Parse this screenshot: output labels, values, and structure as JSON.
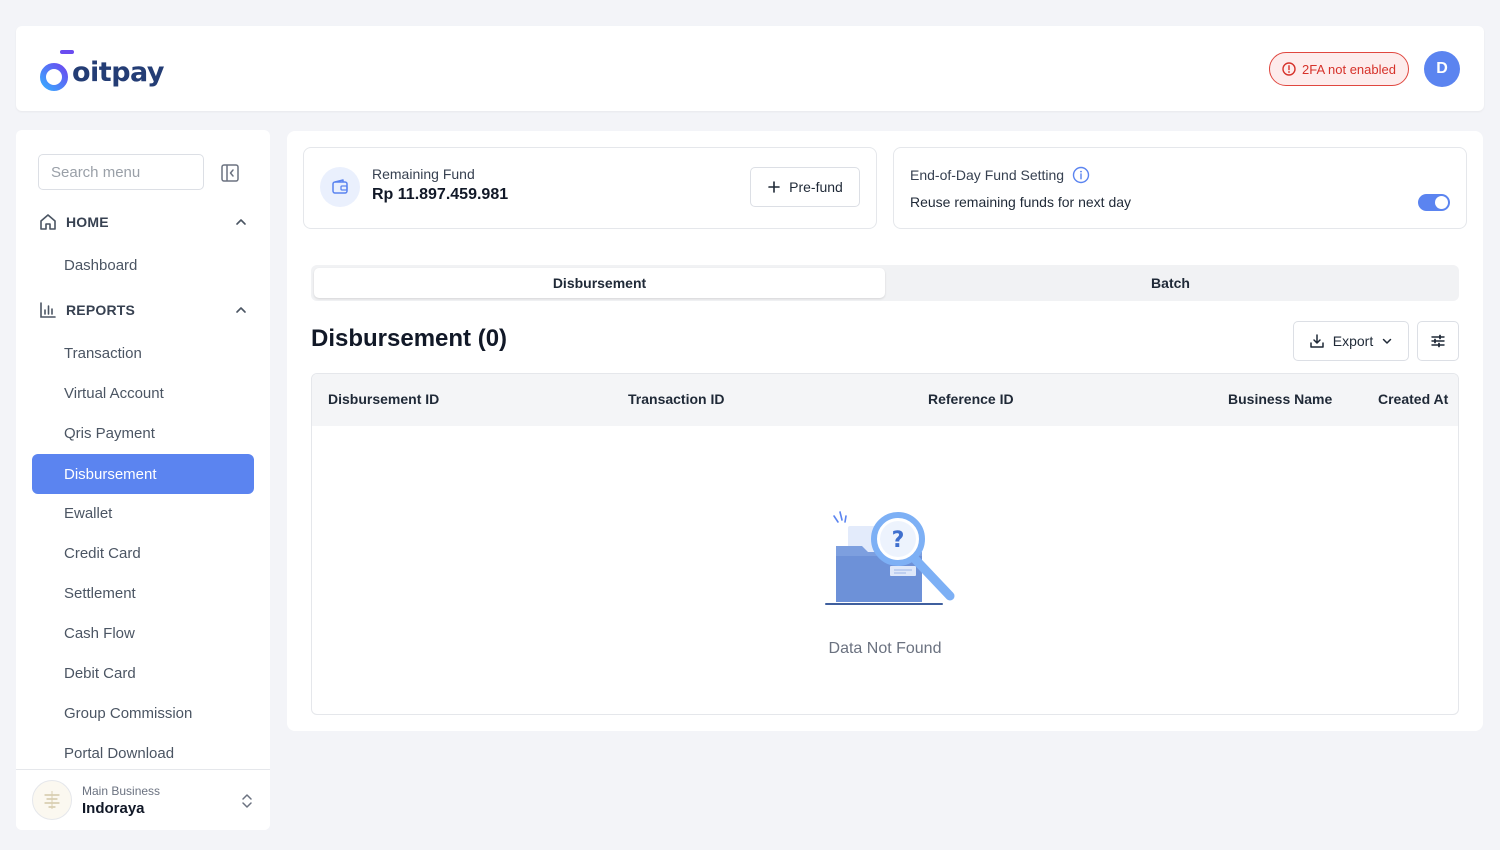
{
  "header": {
    "logo_text": "oitpay",
    "badge_2fa": "2FA not enabled",
    "avatar_initial": "D",
    "brand_color": "#5b84f0"
  },
  "sidebar": {
    "search_placeholder": "Search menu",
    "sections": [
      {
        "label": "HOME",
        "items": [
          "Dashboard"
        ]
      },
      {
        "label": "REPORTS",
        "items": [
          "Transaction",
          "Virtual Account",
          "Qris Payment",
          "Disbursement",
          "Ewallet",
          "Credit Card",
          "Settlement",
          "Cash Flow",
          "Debit Card",
          "Group Commission",
          "Portal Download"
        ]
      }
    ],
    "active_item": "Disbursement",
    "business": {
      "subtitle": "Main Business",
      "name": "Indoraya"
    }
  },
  "fund": {
    "label": "Remaining Fund",
    "value": "Rp 11.897.459.981",
    "prefund_label": "Pre-fund"
  },
  "eod": {
    "title": "End-of-Day Fund Setting",
    "description": "Reuse remaining funds for next day",
    "toggle_on": true
  },
  "tabs": [
    {
      "label": "Disbursement",
      "active": true
    },
    {
      "label": "Batch",
      "active": false
    }
  ],
  "page": {
    "title": "Disbursement (0)",
    "export_label": "Export"
  },
  "table": {
    "columns": [
      "Disbursement ID",
      "Transaction ID",
      "Reference ID",
      "Business Name",
      "Created At"
    ],
    "rows": [],
    "empty_text": "Data Not Found"
  }
}
